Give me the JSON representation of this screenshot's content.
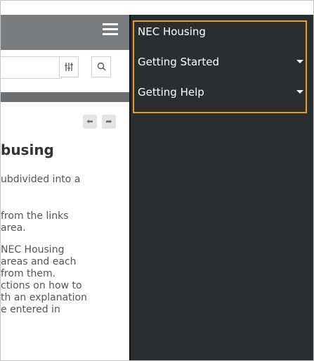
{
  "left_pane": {
    "heading": "busing",
    "paragraph_lines": [
      "ubdivided into a",
      "",
      "from the links",
      "area.",
      "NEC Housing",
      "areas and each",
      "from them.",
      "ctions on how to",
      "th an explanation",
      "e entered in"
    ],
    "search": {
      "value": "",
      "placeholder": ""
    }
  },
  "icons": {
    "menu": "hamburger-icon",
    "filter": "filter-sliders-icon",
    "search": "search-icon",
    "back": "back-arrow-icon",
    "forward": "forward-arrow-icon",
    "expand": "caret-down-icon"
  },
  "menu": {
    "items": [
      {
        "label": "NEC Housing",
        "has_submenu": false
      },
      {
        "label": "Getting Started",
        "has_submenu": true
      },
      {
        "label": "Getting Help",
        "has_submenu": true
      }
    ]
  },
  "colors": {
    "header_gray": "#7a7d80",
    "panel_dark": "#2b2e31",
    "highlight_orange": "#f29a1b",
    "menu_text": "#ffffff"
  }
}
